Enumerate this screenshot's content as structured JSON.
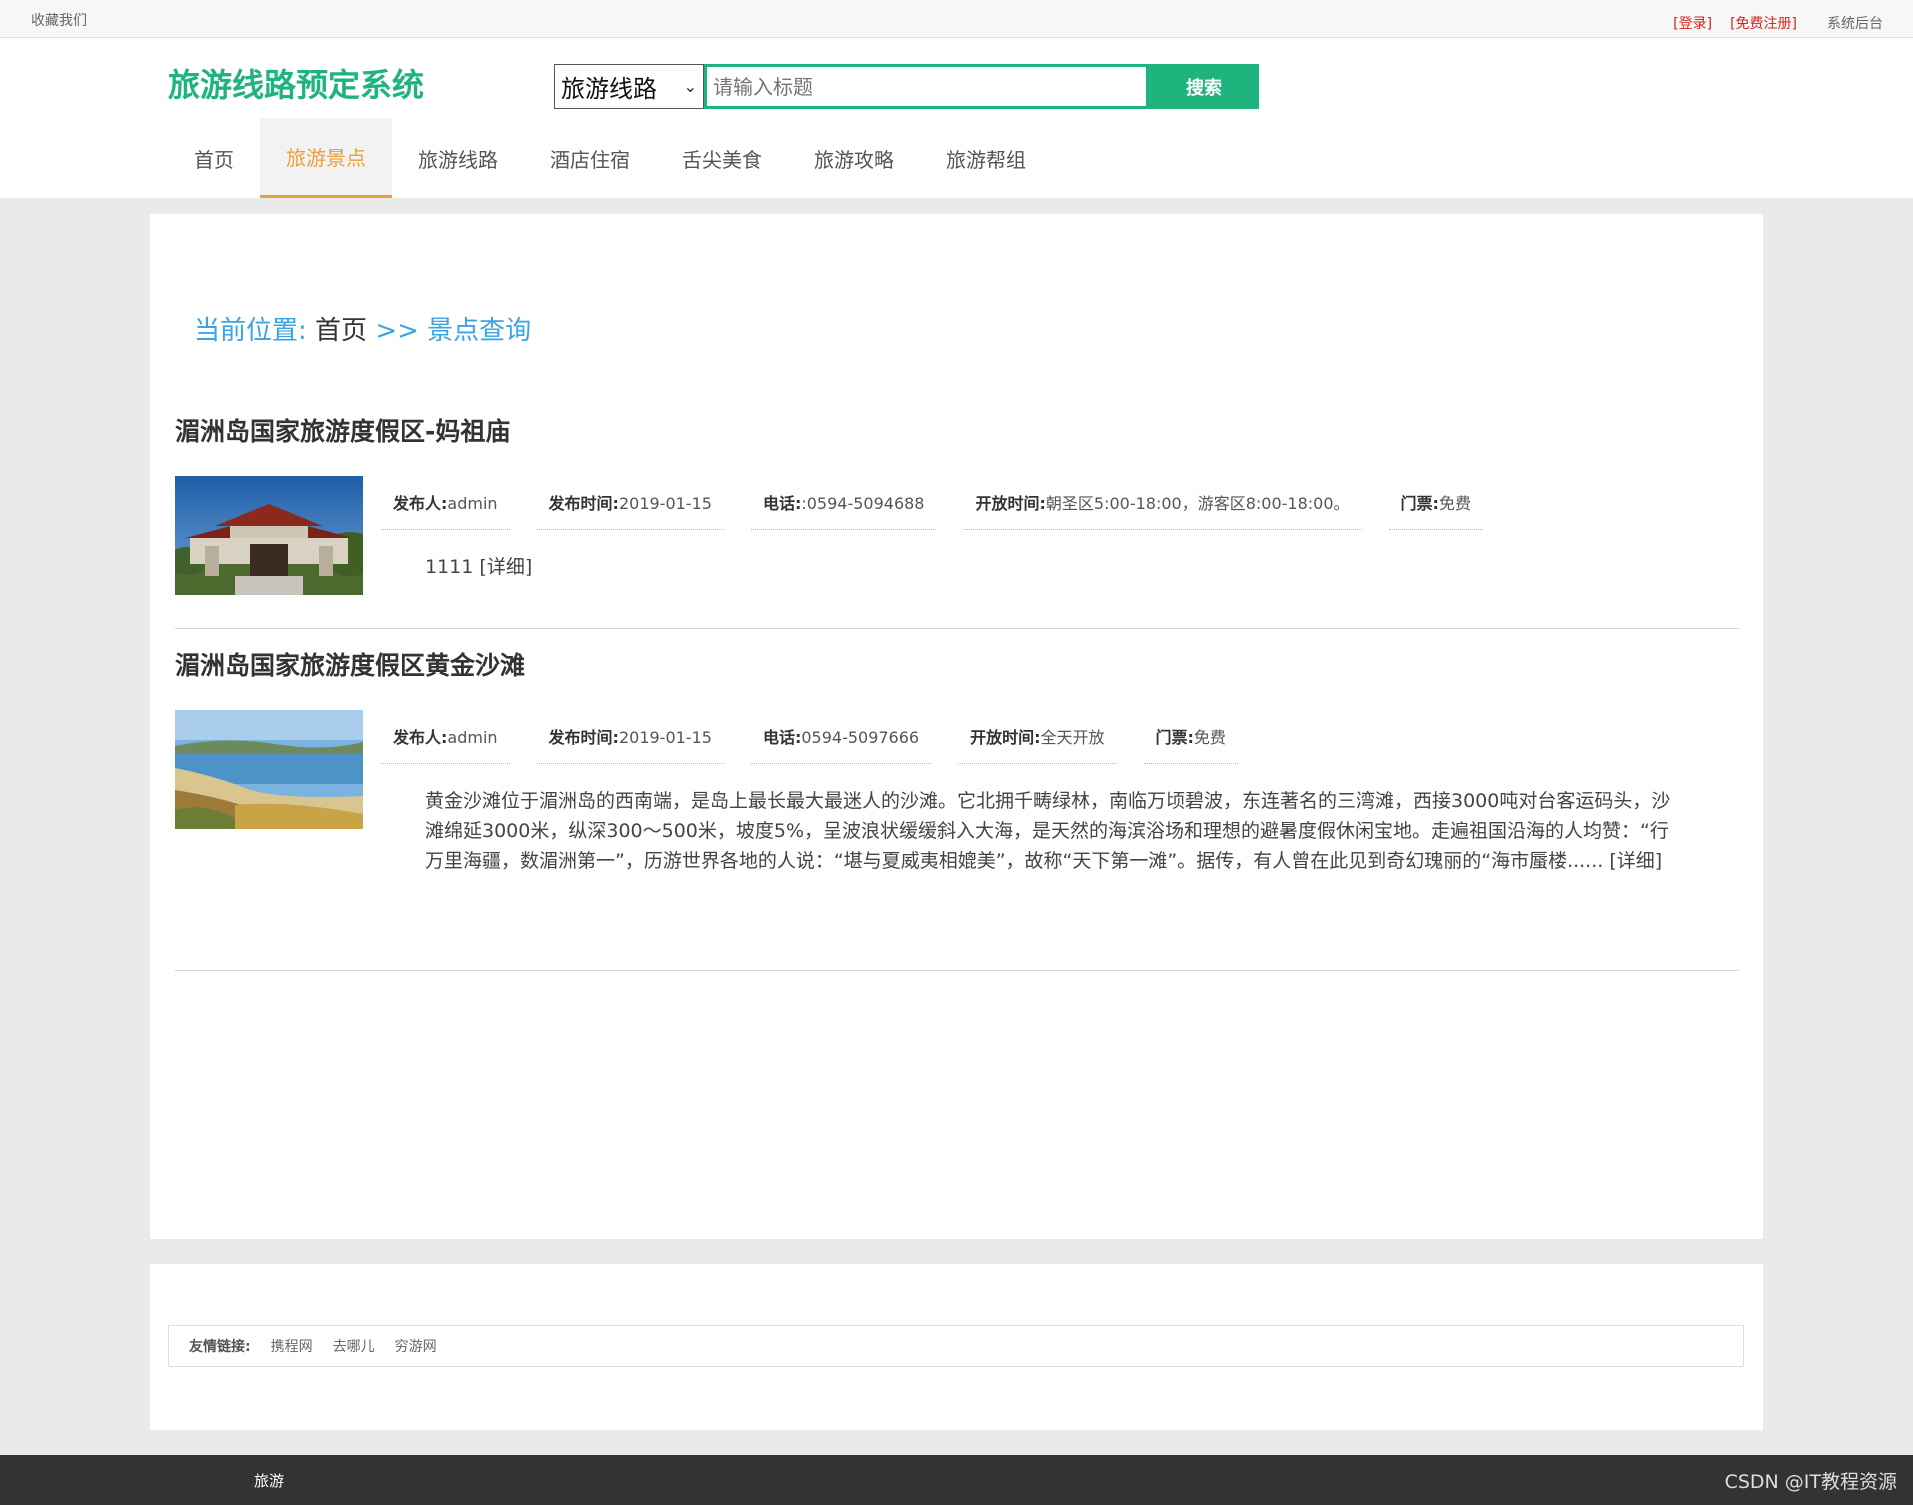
{
  "topbar": {
    "favorite": "收藏我们",
    "login": "[登录]",
    "register": "[免费注册]",
    "admin": "系统后台"
  },
  "header": {
    "logo": "旅游线路预定系统",
    "search": {
      "select_value": "旅游线路",
      "placeholder": "请输入标题",
      "button": "搜索"
    },
    "nav": [
      {
        "label": "首页"
      },
      {
        "label": "旅游景点",
        "active": true
      },
      {
        "label": "旅游线路"
      },
      {
        "label": "酒店住宿"
      },
      {
        "label": "舌尖美食"
      },
      {
        "label": "旅游攻略"
      },
      {
        "label": "旅游帮组"
      }
    ]
  },
  "breadcrumb": {
    "prefix": "当前位置:",
    "home": "首页",
    "sep": ">>",
    "current": "景点查询"
  },
  "entries": [
    {
      "title": "湄洲岛国家旅游度假区-妈祖庙",
      "publisher_label": "发布人:",
      "publisher": "admin",
      "date_label": "发布时间:",
      "date": "2019-01-15",
      "phone_label": "电话:",
      "phone": ":0594-5094688",
      "open_label": "开放时间:",
      "open": "朝圣区5:00-18:00，游客区8:00-18:00。",
      "ticket_label": "门票:",
      "ticket": "免费",
      "desc": "1111",
      "more": "[详细]"
    },
    {
      "title": "湄洲岛国家旅游度假区黄金沙滩",
      "publisher_label": "发布人:",
      "publisher": "admin",
      "date_label": "发布时间:",
      "date": "2019-01-15",
      "phone_label": "电话:",
      "phone": "0594-5097666",
      "open_label": "开放时间:",
      "open": "全天开放",
      "ticket_label": "门票:",
      "ticket": "免费",
      "desc": "黄金沙滩位于湄洲岛的西南端，是岛上最长最大最迷人的沙滩。它北拥千畴绿林，南临万顷碧波，东连著名的三湾滩，西接3000吨对台客运码头，沙滩绵延3000米，纵深300～500米，坡度5%，呈波浪状缓缓斜入大海，是天然的海滨浴场和理想的避暑度假休闲宝地。走遍祖国沿海的人均赞：“行万里海疆，数湄洲第一”，历游世界各地的人说：“堪与夏威夷相媲美”，故称“天下第一滩”。据传，有人曾在此见到奇幻瑰丽的“海市蜃楼......",
      "more": "[详细]"
    }
  ],
  "links": {
    "label": "友情链接:",
    "items": [
      "携程网",
      "去哪儿",
      "穷游网"
    ]
  },
  "footer": {
    "text": "旅游",
    "watermark": "CSDN @IT教程资源"
  },
  "colors": {
    "brand": "#1fb37e",
    "active_nav": "#e6a23c",
    "breadcrumb": "#3aa3e3",
    "topbar_link": "#d9261c"
  }
}
